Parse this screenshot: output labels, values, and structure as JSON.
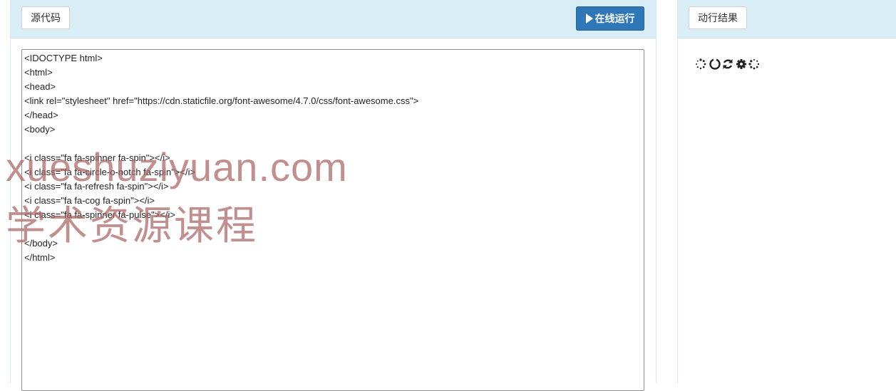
{
  "left_panel": {
    "source_button_label": "源代码",
    "run_button_label": "在线运行",
    "code_lines": [
      "<IDOCTYPE html>",
      "<html>",
      "<head>",
      "<link rel=\"stylesheet\" href=\"https://cdn.staticfile.org/font-awesome/4.7.0/css/font-awesome.css\">",
      "</head>",
      "<body>",
      "",
      "<i class=\"fa fa-spinner fa-spin\"></i>",
      "<i class=\"fa fa-circle-o-notch fa-spin\"></i>",
      "<i class=\"fa fa-refresh fa-spin\"></i>",
      "<i class=\"fa fa-cog fa-spin\"></i>",
      "<i class=\"fa fa-spinner fa-pulse\"></i>",
      "",
      "</body>",
      "</html>"
    ]
  },
  "right_panel": {
    "result_button_label": "动行结果",
    "icons": [
      "spinner-icon",
      "circle-o-notch-icon",
      "refresh-icon",
      "cog-icon",
      "spinner-pulse-icon"
    ]
  },
  "watermark": {
    "line1": "xueshuziyuan.com",
    "line2": "学术资源课程"
  },
  "colors": {
    "header_bg": "#d9edf7",
    "primary_button": "#2e78b8",
    "watermark": "#aa6464"
  }
}
